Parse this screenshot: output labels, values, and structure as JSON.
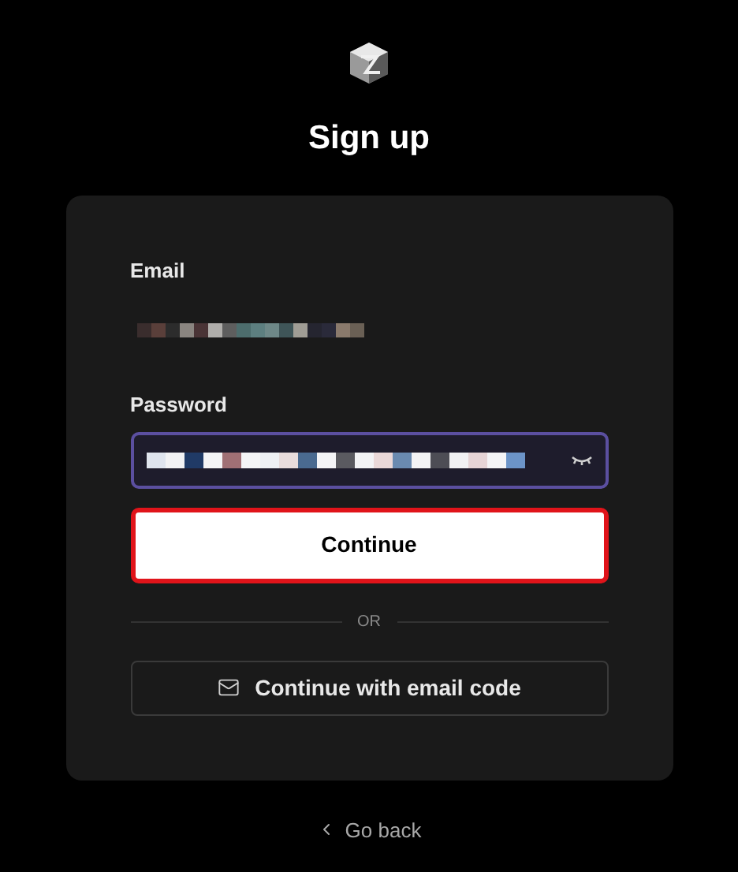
{
  "title": "Sign up",
  "form": {
    "email": {
      "label": "Email"
    },
    "password": {
      "label": "Password",
      "focused": true
    },
    "continue_button": {
      "label": "Continue",
      "highlighted": true
    },
    "divider": "OR",
    "email_code_button": {
      "label": "Continue with email code"
    }
  },
  "back_link": {
    "label": "Go back"
  }
}
